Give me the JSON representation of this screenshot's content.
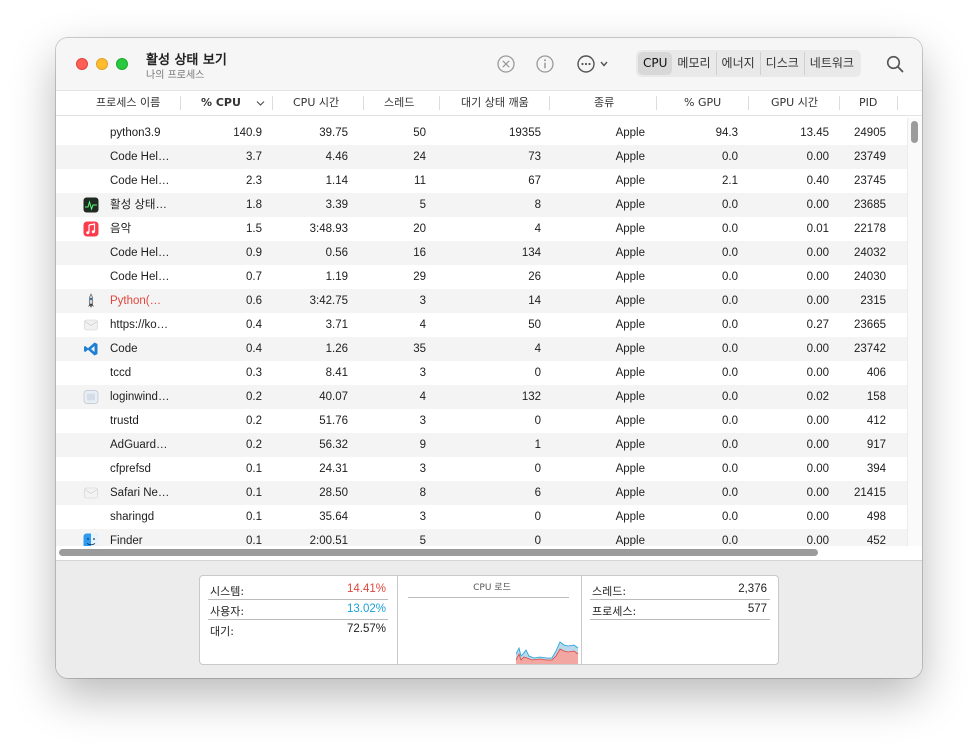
{
  "window": {
    "title": "활성 상태 보기",
    "subtitle": "나의 프로세스"
  },
  "toolbar": {
    "stop_icon": "stop-process-icon",
    "info_icon": "info-icon",
    "more_icon": "ellipsis-circle-icon",
    "tabs": [
      "CPU",
      "메모리",
      "에너지",
      "디스크",
      "네트워크"
    ],
    "active_tab": "CPU",
    "search_icon": "magnifying-glass-icon"
  },
  "table": {
    "columns": [
      "프로세스 이름",
      "% CPU",
      "CPU 시간",
      "스레드",
      "대기 상태 깨움",
      "종류",
      "% GPU",
      "GPU 시간",
      "PID"
    ],
    "sorted_column": "% CPU",
    "rows": [
      {
        "name": "python3.9",
        "cpu": "140.9",
        "time": "39.75",
        "threads": "50",
        "wakeups": "19355",
        "kind": "Apple",
        "gpu": "94.3",
        "gputime": "13.45",
        "pid": "24905",
        "icon": "none"
      },
      {
        "name": "Code Hel…",
        "cpu": "3.7",
        "time": "4.46",
        "threads": "24",
        "wakeups": "73",
        "kind": "Apple",
        "gpu": "0.0",
        "gputime": "0.00",
        "pid": "23749",
        "icon": "none"
      },
      {
        "name": "Code Hel…",
        "cpu": "2.3",
        "time": "1.14",
        "threads": "11",
        "wakeups": "67",
        "kind": "Apple",
        "gpu": "2.1",
        "gputime": "0.40",
        "pid": "23745",
        "icon": "none"
      },
      {
        "name": "활성 상태…",
        "cpu": "1.8",
        "time": "3.39",
        "threads": "5",
        "wakeups": "8",
        "kind": "Apple",
        "gpu": "0.0",
        "gputime": "0.00",
        "pid": "23685",
        "icon": "activity-monitor-icon"
      },
      {
        "name": "음악",
        "cpu": "1.5",
        "time": "3:48.93",
        "threads": "20",
        "wakeups": "4",
        "kind": "Apple",
        "gpu": "0.0",
        "gputime": "0.01",
        "pid": "22178",
        "icon": "music-icon"
      },
      {
        "name": "Code Hel…",
        "cpu": "0.9",
        "time": "0.56",
        "threads": "16",
        "wakeups": "134",
        "kind": "Apple",
        "gpu": "0.0",
        "gputime": "0.00",
        "pid": "24032",
        "icon": "none"
      },
      {
        "name": "Code Hel…",
        "cpu": "0.7",
        "time": "1.19",
        "threads": "29",
        "wakeups": "26",
        "kind": "Apple",
        "gpu": "0.0",
        "gputime": "0.00",
        "pid": "24030",
        "icon": "none"
      },
      {
        "name": "Python(…",
        "cpu": "0.6",
        "time": "3:42.75",
        "threads": "3",
        "wakeups": "14",
        "kind": "Apple",
        "gpu": "0.0",
        "gputime": "0.00",
        "pid": "2315",
        "icon": "python-rocket-icon",
        "warning": true
      },
      {
        "name": "https://ko…",
        "cpu": "0.4",
        "time": "3.71",
        "threads": "4",
        "wakeups": "50",
        "kind": "Apple",
        "gpu": "0.0",
        "gputime": "0.27",
        "pid": "23665",
        "icon": "web-content-icon"
      },
      {
        "name": "Code",
        "cpu": "0.4",
        "time": "1.26",
        "threads": "35",
        "wakeups": "4",
        "kind": "Apple",
        "gpu": "0.0",
        "gputime": "0.00",
        "pid": "23742",
        "icon": "vscode-icon"
      },
      {
        "name": "tccd",
        "cpu": "0.3",
        "time": "8.41",
        "threads": "3",
        "wakeups": "0",
        "kind": "Apple",
        "gpu": "0.0",
        "gputime": "0.00",
        "pid": "406",
        "icon": "none"
      },
      {
        "name": "loginwind…",
        "cpu": "0.2",
        "time": "40.07",
        "threads": "4",
        "wakeups": "132",
        "kind": "Apple",
        "gpu": "0.0",
        "gputime": "0.02",
        "pid": "158",
        "icon": "loginwindow-icon"
      },
      {
        "name": "trustd",
        "cpu": "0.2",
        "time": "51.76",
        "threads": "3",
        "wakeups": "0",
        "kind": "Apple",
        "gpu": "0.0",
        "gputime": "0.00",
        "pid": "412",
        "icon": "none"
      },
      {
        "name": "AdGuard…",
        "cpu": "0.2",
        "time": "56.32",
        "threads": "9",
        "wakeups": "1",
        "kind": "Apple",
        "gpu": "0.0",
        "gputime": "0.00",
        "pid": "917",
        "icon": "none"
      },
      {
        "name": "cfprefsd",
        "cpu": "0.1",
        "time": "24.31",
        "threads": "3",
        "wakeups": "0",
        "kind": "Apple",
        "gpu": "0.0",
        "gputime": "0.00",
        "pid": "394",
        "icon": "none"
      },
      {
        "name": "Safari Ne…",
        "cpu": "0.1",
        "time": "28.50",
        "threads": "8",
        "wakeups": "6",
        "kind": "Apple",
        "gpu": "0.0",
        "gputime": "0.00",
        "pid": "21415",
        "icon": "safari-networking-icon"
      },
      {
        "name": "sharingd",
        "cpu": "0.1",
        "time": "35.64",
        "threads": "3",
        "wakeups": "0",
        "kind": "Apple",
        "gpu": "0.0",
        "gputime": "0.00",
        "pid": "498",
        "icon": "none"
      },
      {
        "name": "Finder",
        "cpu": "0.1",
        "time": "2:00.51",
        "threads": "5",
        "wakeups": "0",
        "kind": "Apple",
        "gpu": "0.0",
        "gputime": "0.00",
        "pid": "452",
        "icon": "finder-icon"
      }
    ]
  },
  "summary": {
    "system_label": "시스템:",
    "system_value": "14.41%",
    "user_label": "사용자:",
    "user_value": "13.02%",
    "idle_label": "대기:",
    "idle_value": "72.57%",
    "cpu_load_title": "CPU 로드",
    "threads_label": "스레드:",
    "threads_value": "2,376",
    "processes_label": "프로세스:",
    "processes_value": "577"
  },
  "colors": {
    "system": "#e0463d",
    "user": "#1a9fd8",
    "warning_text": "#e0463d",
    "close": "#fe5f57",
    "minimize": "#febc2e",
    "maximize": "#28c840"
  }
}
